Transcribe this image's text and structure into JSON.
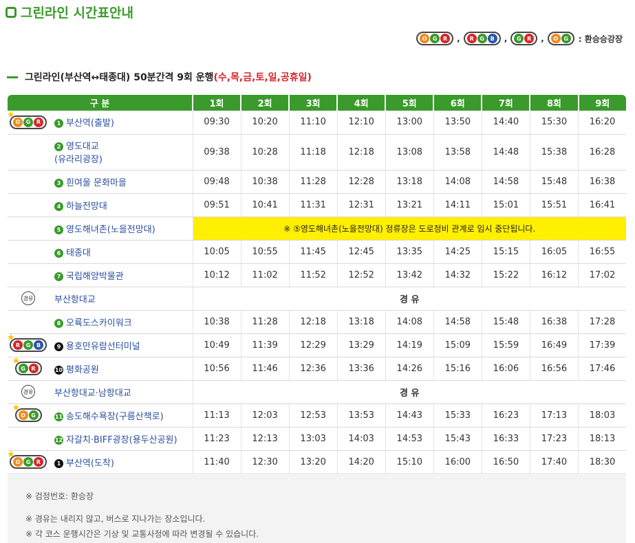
{
  "page_title": "그린라인 시간표안내",
  "legend": {
    "badges": [
      [
        "O",
        "G",
        "R"
      ],
      [
        "R",
        "G",
        "B"
      ],
      [
        "G",
        "R"
      ],
      [
        "O",
        "G"
      ]
    ],
    "separator": ",",
    "label": ": 환승승강장"
  },
  "subtitle": {
    "main": "그린라인(부산역↔태종대) 50분간격 9회 운행",
    "days": "(수,목,금,토,일,공휴일)"
  },
  "table": {
    "header": [
      "구 분",
      "1회",
      "2회",
      "3회",
      "4회",
      "5회",
      "6회",
      "7회",
      "8회",
      "9회"
    ],
    "rows": [
      {
        "icon": {
          "dots": [
            "O",
            "G",
            "R"
          ],
          "star": true
        },
        "num": "1",
        "num_dark": false,
        "name": "부산역(출발)",
        "times": [
          "09:30",
          "10:20",
          "11:10",
          "12:10",
          "13:00",
          "13:50",
          "14:40",
          "15:30",
          "16:20"
        ]
      },
      {
        "icon": null,
        "num": "2",
        "num_dark": false,
        "name": "영도대교",
        "name2": "(유라리광장)",
        "times": [
          "09:38",
          "10:28",
          "11:18",
          "12:18",
          "13:08",
          "13:58",
          "14:48",
          "15:38",
          "16:28"
        ]
      },
      {
        "icon": null,
        "num": "3",
        "num_dark": false,
        "name": "흰여울 문화마을",
        "times": [
          "09:48",
          "10:38",
          "11:28",
          "12:28",
          "13:18",
          "14:08",
          "14:58",
          "15:48",
          "16:38"
        ]
      },
      {
        "icon": null,
        "num": "4",
        "num_dark": false,
        "name": "하늘전망대",
        "times": [
          "09:51",
          "10:41",
          "11:31",
          "12:31",
          "13:21",
          "14:11",
          "15:01",
          "15:51",
          "16:41"
        ]
      },
      {
        "icon": null,
        "num": "5",
        "num_dark": false,
        "name": "영도해녀촌(노을전망대)",
        "notice": "※ ⑤영도해녀촌(노을전망대) 정류장은 도로정비 관계로 임시 중단됩니다."
      },
      {
        "icon": null,
        "num": "6",
        "num_dark": false,
        "name": "태종대",
        "times": [
          "10:05",
          "10:55",
          "11:45",
          "12:45",
          "13:35",
          "14:25",
          "15:15",
          "16:05",
          "16:55"
        ]
      },
      {
        "icon": null,
        "num": "7",
        "num_dark": false,
        "name": "국립해양박물관",
        "times": [
          "10:12",
          "11:02",
          "11:52",
          "12:52",
          "13:42",
          "14:32",
          "15:22",
          "16:12",
          "17:02"
        ]
      },
      {
        "icon": "via",
        "via_icon_text": "경유",
        "num": null,
        "name": "부산항대교",
        "via_text": "경 유"
      },
      {
        "icon": null,
        "num": "8",
        "num_dark": false,
        "name": "오륙도스카이워크",
        "times": [
          "10:38",
          "11:28",
          "12:18",
          "13:18",
          "14:08",
          "14:58",
          "15:48",
          "16:38",
          "17:28"
        ]
      },
      {
        "icon": {
          "dots": [
            "R",
            "G",
            "B"
          ],
          "star": true
        },
        "num": "9",
        "num_dark": true,
        "name": "용호만유람선터미널",
        "times": [
          "10:49",
          "11:39",
          "12:29",
          "13:29",
          "14:19",
          "15:09",
          "15:59",
          "16:49",
          "17:39"
        ]
      },
      {
        "icon": {
          "dots": [
            "G",
            "R"
          ],
          "star": true
        },
        "num": "10",
        "num_dark": true,
        "name": "평화공원",
        "times": [
          "10:56",
          "11:46",
          "12:36",
          "13:36",
          "14:26",
          "15:16",
          "16:06",
          "16:56",
          "17:46"
        ]
      },
      {
        "icon": "via",
        "via_icon_text": "경유",
        "num": null,
        "name": "부산항대교·남항대교",
        "via_text": "경 유"
      },
      {
        "icon": {
          "dots": [
            "O",
            "G"
          ],
          "star": true
        },
        "num": "11",
        "num_dark": false,
        "name": "송도해수욕장(구름산책로)",
        "times": [
          "11:13",
          "12:03",
          "12:53",
          "13:53",
          "14:43",
          "15:33",
          "16:23",
          "17:13",
          "18:03"
        ]
      },
      {
        "icon": null,
        "num": "12",
        "num_dark": false,
        "name": "자갈치·BIFF광장(용두산공원)",
        "times": [
          "11:23",
          "12:13",
          "13:03",
          "14:03",
          "14:53",
          "15:43",
          "16:33",
          "17:23",
          "18:13"
        ]
      },
      {
        "icon": {
          "dots": [
            "O",
            "G",
            "R"
          ],
          "star": true
        },
        "num": "1",
        "num_dark": true,
        "name": "부산역(도착)",
        "times": [
          "11:40",
          "12:30",
          "13:20",
          "14:20",
          "15:10",
          "16:00",
          "16:50",
          "17:40",
          "18:30"
        ]
      }
    ]
  },
  "notes": [
    "※ 검정번호: 환승장",
    "※ 경유는 내리지 않고, 버스로 지나가는 장소입니다.",
    "※ 각 코스 운행시간은 기상 및 교통사정에 따라 변경될 수 있습니다."
  ],
  "colors": {
    "green": "#3a9a2b",
    "red": "#d6262c",
    "orange": "#f08a1c",
    "blue": "#2a55a8",
    "notice_yellow": "#ffef00"
  }
}
